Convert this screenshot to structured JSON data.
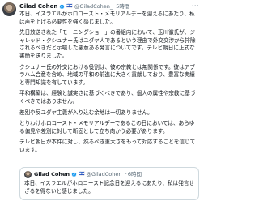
{
  "post": {
    "author_name": "Gilad Cohen",
    "flag": "🇮🇱",
    "handle": "@GiladCohen_",
    "separator": "·",
    "time": "5時間",
    "more": "···",
    "paragraphs": [
      "本日、イスラエルがホロコースト・メモリアルデーを迎えるにあたり、私は声を上げる必要性を強く感じました。",
      "先日放送された「モーニングショー」の番組内において、玉川徹氏が、ジャレッド・クシュナー氏はユダヤ人であるという理由で外交交渉から排除されるべきだと示唆した悪意ある発言についてです。テレビ朝日に正式な書簡を送りました。",
      "クシュナー氏の外交における役割は、彼の宗教とは無関係です。彼はアブラハム合意を含め、地域の平和の前進に大きく貢献しており、豊富な実績と専門知識を有しています。",
      "平和構築は、経験と誠実さに基づくべきであり、個人の属性や宗教に基づくべきではありません。",
      "差別や反ユダヤ主義が入り込む余地は一切ありません。",
      "とりわけホロコースト・メモリアルデーであるこの日においては、あらゆる偏見や差別に対して断固として立ち向かう必要があります。",
      "テレビ朝日が本件に対し、然るべき重大さをもって対応することを信じています。"
    ]
  },
  "quoted_post": {
    "author_name": "Gilad Cohen",
    "flag": "🇮🇱",
    "handle": "@GiladCohen_",
    "separator": "·",
    "time": "6時間",
    "text": "本日、イスラエルがホロコースト記念日を迎えるにあたり、私は発言せざるを得ないと感じました。"
  }
}
